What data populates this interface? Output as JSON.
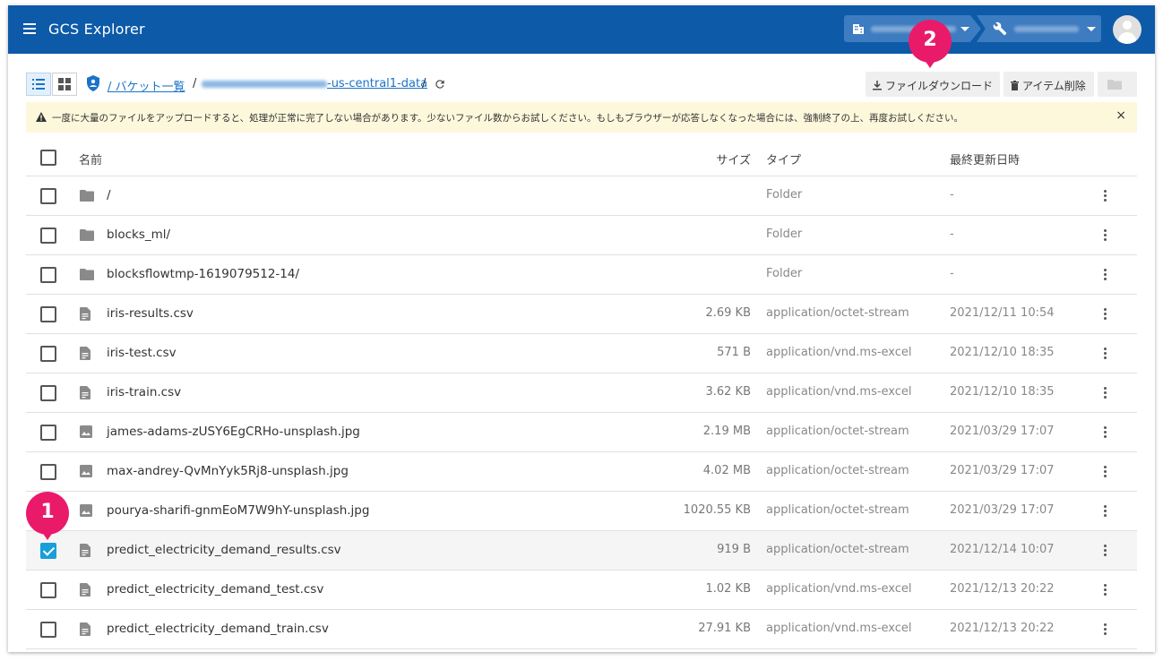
{
  "app": {
    "title": "GCS Explorer"
  },
  "toolbar": {
    "breadcrumb_root": "/ バケット一覧",
    "breadcrumb_bucket_suffix": "-us-central1-data",
    "breadcrumb_sep": "/",
    "download_label": "ファイルダウンロード",
    "delete_label": "アイテム削除"
  },
  "notice": {
    "text": "一度に大量のファイルをアップロードすると、処理が正常に完了しない場合があります。少ないファイル数からお試しください。もしもブラウザーが応答しなくなった場合には、強制終了の上、再度お試しください。",
    "close": "×"
  },
  "table": {
    "headers": {
      "name": "名前",
      "size": "サイズ",
      "type": "タイプ",
      "modified": "最終更新日時"
    },
    "rows": [
      {
        "icon": "folder-icon",
        "name": "/",
        "size": "",
        "type": "Folder",
        "modified": "-",
        "checked": false
      },
      {
        "icon": "folder-icon",
        "name": "blocks_ml/",
        "size": "",
        "type": "Folder",
        "modified": "-",
        "checked": false
      },
      {
        "icon": "folder-icon",
        "name": "blocksflowtmp-1619079512-14/",
        "size": "",
        "type": "Folder",
        "modified": "-",
        "checked": false
      },
      {
        "icon": "file-icon",
        "name": "iris-results.csv",
        "size": "2.69 KB",
        "type": "application/octet-stream",
        "modified": "2021/12/11 10:54",
        "checked": false
      },
      {
        "icon": "file-icon",
        "name": "iris-test.csv",
        "size": "571 B",
        "type": "application/vnd.ms-excel",
        "modified": "2021/12/10 18:35",
        "checked": false
      },
      {
        "icon": "file-icon",
        "name": "iris-train.csv",
        "size": "3.62 KB",
        "type": "application/vnd.ms-excel",
        "modified": "2021/12/10 18:35",
        "checked": false
      },
      {
        "icon": "image-icon",
        "name": "james-adams-zUSY6EgCRHo-unsplash.jpg",
        "size": "2.19 MB",
        "type": "application/octet-stream",
        "modified": "2021/03/29 17:07",
        "checked": false
      },
      {
        "icon": "image-icon",
        "name": "max-andrey-QvMnYyk5Rj8-unsplash.jpg",
        "size": "4.02 MB",
        "type": "application/octet-stream",
        "modified": "2021/03/29 17:07",
        "checked": false
      },
      {
        "icon": "image-icon",
        "name": "pourya-sharifi-gnmEoM7W9hY-unsplash.jpg",
        "size": "1020.55 KB",
        "type": "application/octet-stream",
        "modified": "2021/03/29 17:07",
        "checked": false
      },
      {
        "icon": "file-icon",
        "name": "predict_electricity_demand_results.csv",
        "size": "919 B",
        "type": "application/octet-stream",
        "modified": "2021/12/14 10:07",
        "checked": true
      },
      {
        "icon": "file-icon",
        "name": "predict_electricity_demand_test.csv",
        "size": "1.02 KB",
        "type": "application/vnd.ms-excel",
        "modified": "2021/12/13 20:22",
        "checked": false
      },
      {
        "icon": "file-icon",
        "name": "predict_electricity_demand_train.csv",
        "size": "27.91 KB",
        "type": "application/vnd.ms-excel",
        "modified": "2021/12/13 20:22",
        "checked": false
      }
    ]
  },
  "callouts": [
    {
      "label": "1"
    },
    {
      "label": "2"
    }
  ],
  "colors": {
    "appbar": "#0d5aa8",
    "accent": "#1a9ed9",
    "callout": "#ea1a6b",
    "notice": "#fdf8dc"
  }
}
